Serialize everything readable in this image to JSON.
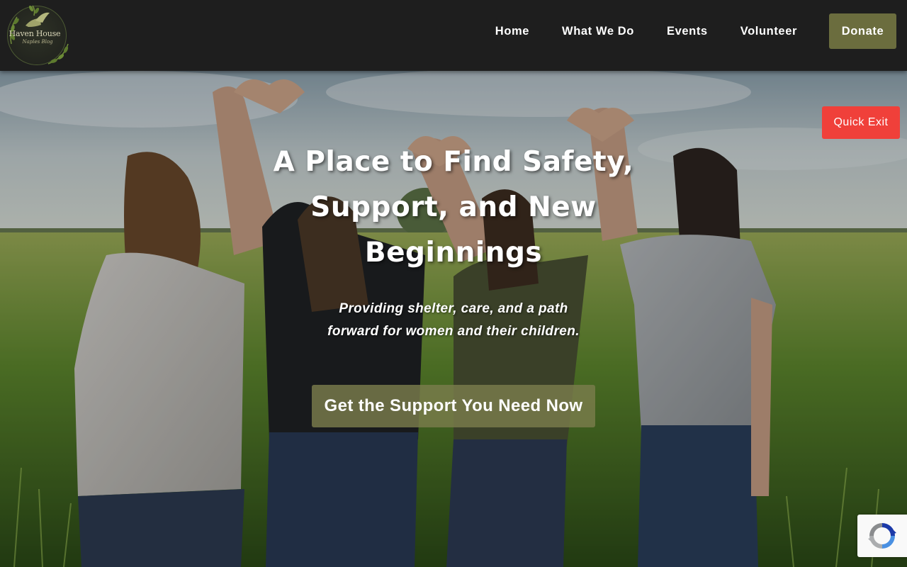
{
  "brand": {
    "name": "Haven House",
    "tagline": "Naples Blog"
  },
  "nav": {
    "items": [
      {
        "label": "Home"
      },
      {
        "label": "What We Do"
      },
      {
        "label": "Events"
      },
      {
        "label": "Volunteer"
      }
    ],
    "donate_label": "Donate"
  },
  "hero": {
    "heading_lines": [
      "A Place to Find Safety,",
      "Support, and New",
      "Beginnings"
    ],
    "subheading_lines": [
      "Providing shelter, care, and a path",
      "forward for women and their children."
    ],
    "cta_label": "Get the Support You Need Now"
  },
  "quick_exit": {
    "label": "Quick Exit"
  },
  "widgets": {
    "recaptcha_icon": "recaptcha-icon"
  },
  "colors": {
    "header_bg": "#1e1e1e",
    "donate_bg": "#6b6d3e",
    "cta_bg": "#7a7c4c",
    "quick_exit_bg": "#f0403a",
    "text": "#ffffff"
  }
}
